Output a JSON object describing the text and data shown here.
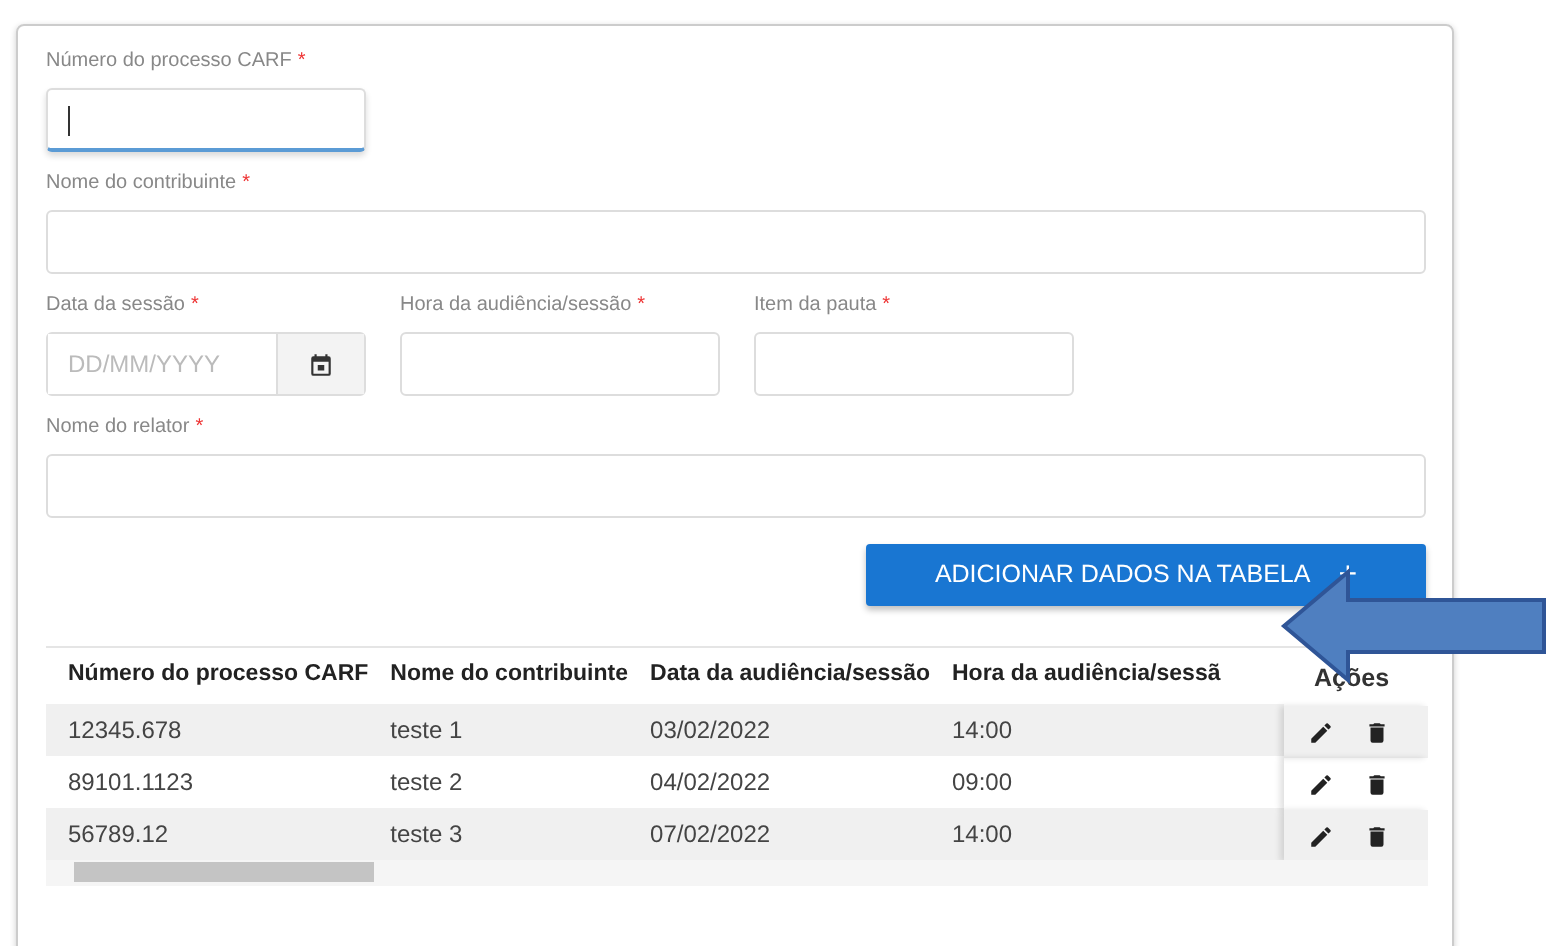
{
  "form": {
    "rows": [
      [
        {
          "label": "Número do processo CARF",
          "required_mark": "*",
          "kind": "text",
          "focused": true
        }
      ],
      [
        {
          "label": "Nome do contribuinte",
          "required_mark": "*",
          "kind": "text",
          "focused": false
        }
      ],
      [
        {
          "label": "Data da sessão",
          "required_mark": "*",
          "kind": "date",
          "placeholder": "DD/MM/YYYY",
          "focused": false
        },
        {
          "label": "Hora da audiência/sessão",
          "required_mark": "*",
          "kind": "text",
          "focused": false
        },
        {
          "label": "Item da pauta",
          "required_mark": "*",
          "kind": "text",
          "focused": false
        }
      ],
      [
        {
          "label": "Nome do relator",
          "required_mark": "*",
          "kind": "text",
          "focused": false
        }
      ]
    ],
    "add_button": {
      "label": "ADICIONAR DADOS NA TABELA",
      "icon": "+"
    }
  },
  "table": {
    "columns": [
      "Número do processo CARF",
      "Nome do contribuinte",
      "Data da audiência/sessão",
      "Hora da audiência/sessã",
      "Ações"
    ],
    "rows": [
      {
        "cells": [
          "12345.678",
          "teste 1",
          "03/02/2022",
          "14:00"
        ]
      },
      {
        "cells": [
          "89101.1123",
          "teste 2",
          "04/02/2022",
          "09:00"
        ]
      },
      {
        "cells": [
          "56789.12",
          "teste 3",
          "07/02/2022",
          "14:00"
        ]
      }
    ]
  },
  "annotation": {
    "kind": "arrow"
  }
}
